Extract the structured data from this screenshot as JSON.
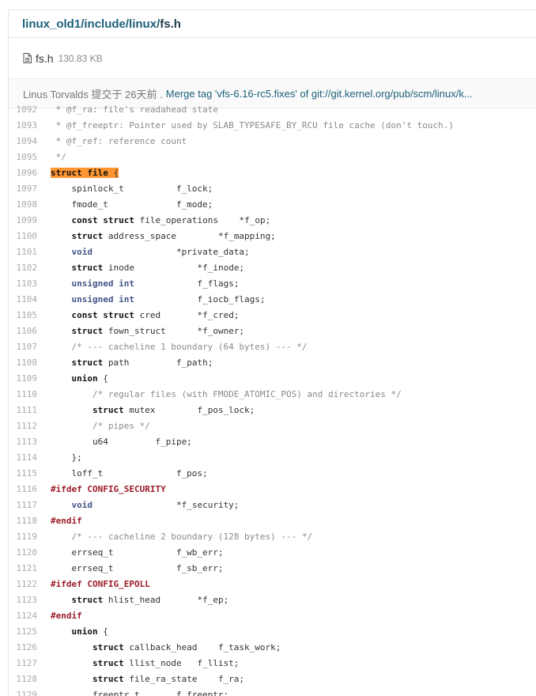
{
  "breadcrumb": {
    "parts": [
      "linux_old1",
      "include",
      "linux"
    ],
    "separator": "/",
    "current": "fs.h"
  },
  "file": {
    "icon": "file-text-icon",
    "name": "fs.h",
    "size": "130.83 KB"
  },
  "commit": {
    "author": "Linus Torvalds 提交于 26天前 .",
    "message": "Merge tag 'vfs-6.16-rc5.fixes' of git://git.kernel.org/pub/scm/linux/k..."
  },
  "colors": {
    "link": "#1b5f7a",
    "highlight": "#ff9632",
    "preprocessor": "#9c1c28",
    "type": "#445588",
    "comment": "#8a8a8a"
  },
  "code": {
    "lines": [
      {
        "n": "1092",
        "t": [
          {
            "c": "cm",
            "s": " * @f_ra: file's readahead state"
          }
        ]
      },
      {
        "n": "1093",
        "t": [
          {
            "c": "cm",
            "s": " * @f_freeptr: Pointer used by SLAB_TYPESAFE_BY_RCU file cache (don't touch.)"
          }
        ]
      },
      {
        "n": "1094",
        "t": [
          {
            "c": "cm",
            "s": " * @f_ref: reference count"
          }
        ]
      },
      {
        "n": "1095",
        "t": [
          {
            "c": "cm",
            "s": " */"
          }
        ]
      },
      {
        "n": "1096",
        "t": [
          {
            "c": "kw hl",
            "s": "struct"
          },
          {
            "c": "hl",
            "s": " "
          },
          {
            "c": "kw hl",
            "s": "file"
          },
          {
            "c": "hl",
            "s": " {"
          }
        ]
      },
      {
        "n": "1097",
        "t": [
          {
            "c": "",
            "s": "    spinlock_t          f_lock;"
          }
        ]
      },
      {
        "n": "1098",
        "t": [
          {
            "c": "",
            "s": "    fmode_t             f_mode;"
          }
        ]
      },
      {
        "n": "1099",
        "t": [
          {
            "c": "",
            "s": "    "
          },
          {
            "c": "kw",
            "s": "const"
          },
          {
            "c": "",
            "s": " "
          },
          {
            "c": "kw",
            "s": "struct"
          },
          {
            "c": "",
            "s": " file_operations    *f_op;"
          }
        ]
      },
      {
        "n": "1100",
        "t": [
          {
            "c": "",
            "s": "    "
          },
          {
            "c": "kw",
            "s": "struct"
          },
          {
            "c": "",
            "s": " address_space        *f_mapping;"
          }
        ]
      },
      {
        "n": "1101",
        "t": [
          {
            "c": "",
            "s": "    "
          },
          {
            "c": "ty",
            "s": "void"
          },
          {
            "c": "",
            "s": "                *private_data;"
          }
        ]
      },
      {
        "n": "1102",
        "t": [
          {
            "c": "",
            "s": "    "
          },
          {
            "c": "kw",
            "s": "struct"
          },
          {
            "c": "",
            "s": " inode            *f_inode;"
          }
        ]
      },
      {
        "n": "1103",
        "t": [
          {
            "c": "",
            "s": "    "
          },
          {
            "c": "ty",
            "s": "unsigned"
          },
          {
            "c": "",
            "s": " "
          },
          {
            "c": "ty",
            "s": "int"
          },
          {
            "c": "",
            "s": "            f_flags;"
          }
        ]
      },
      {
        "n": "1104",
        "t": [
          {
            "c": "",
            "s": "    "
          },
          {
            "c": "ty",
            "s": "unsigned"
          },
          {
            "c": "",
            "s": " "
          },
          {
            "c": "ty",
            "s": "int"
          },
          {
            "c": "",
            "s": "            f_iocb_flags;"
          }
        ]
      },
      {
        "n": "1105",
        "t": [
          {
            "c": "",
            "s": "    "
          },
          {
            "c": "kw",
            "s": "const"
          },
          {
            "c": "",
            "s": " "
          },
          {
            "c": "kw",
            "s": "struct"
          },
          {
            "c": "",
            "s": " cred       *f_cred;"
          }
        ]
      },
      {
        "n": "1106",
        "t": [
          {
            "c": "",
            "s": "    "
          },
          {
            "c": "kw",
            "s": "struct"
          },
          {
            "c": "",
            "s": " fown_struct      *f_owner;"
          }
        ]
      },
      {
        "n": "1107",
        "t": [
          {
            "c": "",
            "s": "    "
          },
          {
            "c": "cm",
            "s": "/* --- cacheline 1 boundary (64 bytes) --- */"
          }
        ]
      },
      {
        "n": "1108",
        "t": [
          {
            "c": "",
            "s": "    "
          },
          {
            "c": "kw",
            "s": "struct"
          },
          {
            "c": "",
            "s": " path         f_path;"
          }
        ]
      },
      {
        "n": "1109",
        "t": [
          {
            "c": "",
            "s": "    "
          },
          {
            "c": "kw",
            "s": "union"
          },
          {
            "c": "",
            "s": " {"
          }
        ]
      },
      {
        "n": "1110",
        "t": [
          {
            "c": "",
            "s": "        "
          },
          {
            "c": "cm",
            "s": "/* regular files (with FMODE_ATOMIC_POS) and directories */"
          }
        ]
      },
      {
        "n": "1111",
        "t": [
          {
            "c": "",
            "s": "        "
          },
          {
            "c": "kw",
            "s": "struct"
          },
          {
            "c": "",
            "s": " mutex        f_pos_lock;"
          }
        ]
      },
      {
        "n": "1112",
        "t": [
          {
            "c": "",
            "s": "        "
          },
          {
            "c": "cm",
            "s": "/* pipes */"
          }
        ]
      },
      {
        "n": "1113",
        "t": [
          {
            "c": "",
            "s": "        u64         f_pipe;"
          }
        ]
      },
      {
        "n": "1114",
        "t": [
          {
            "c": "",
            "s": "    };"
          }
        ]
      },
      {
        "n": "1115",
        "t": [
          {
            "c": "",
            "s": "    loff_t              f_pos;"
          }
        ]
      },
      {
        "n": "1116",
        "t": [
          {
            "c": "pp",
            "s": "#ifdef CONFIG_SECURITY"
          }
        ]
      },
      {
        "n": "1117",
        "t": [
          {
            "c": "",
            "s": "    "
          },
          {
            "c": "ty",
            "s": "void"
          },
          {
            "c": "",
            "s": "                *f_security;"
          }
        ]
      },
      {
        "n": "1118",
        "t": [
          {
            "c": "pp",
            "s": "#endif"
          }
        ]
      },
      {
        "n": "1119",
        "t": [
          {
            "c": "",
            "s": "    "
          },
          {
            "c": "cm",
            "s": "/* --- cacheline 2 boundary (128 bytes) --- */"
          }
        ]
      },
      {
        "n": "1120",
        "t": [
          {
            "c": "",
            "s": "    errseq_t            f_wb_err;"
          }
        ]
      },
      {
        "n": "1121",
        "t": [
          {
            "c": "",
            "s": "    errseq_t            f_sb_err;"
          }
        ]
      },
      {
        "n": "1122",
        "t": [
          {
            "c": "pp",
            "s": "#ifdef CONFIG_EPOLL"
          }
        ]
      },
      {
        "n": "1123",
        "t": [
          {
            "c": "",
            "s": "    "
          },
          {
            "c": "kw",
            "s": "struct"
          },
          {
            "c": "",
            "s": " hlist_head       *f_ep;"
          }
        ]
      },
      {
        "n": "1124",
        "t": [
          {
            "c": "pp",
            "s": "#endif"
          }
        ]
      },
      {
        "n": "1125",
        "t": [
          {
            "c": "",
            "s": "    "
          },
          {
            "c": "kw",
            "s": "union"
          },
          {
            "c": "",
            "s": " {"
          }
        ]
      },
      {
        "n": "1126",
        "t": [
          {
            "c": "",
            "s": "        "
          },
          {
            "c": "kw",
            "s": "struct"
          },
          {
            "c": "",
            "s": " callback_head    f_task_work;"
          }
        ]
      },
      {
        "n": "1127",
        "t": [
          {
            "c": "",
            "s": "        "
          },
          {
            "c": "kw",
            "s": "struct"
          },
          {
            "c": "",
            "s": " llist_node   f_llist;"
          }
        ]
      },
      {
        "n": "1128",
        "t": [
          {
            "c": "",
            "s": "        "
          },
          {
            "c": "kw",
            "s": "struct"
          },
          {
            "c": "",
            "s": " file_ra_state    f_ra;"
          }
        ]
      },
      {
        "n": "1129",
        "t": [
          {
            "c": "",
            "s": "        freeptr_t       f_freeptr;"
          }
        ]
      }
    ]
  }
}
